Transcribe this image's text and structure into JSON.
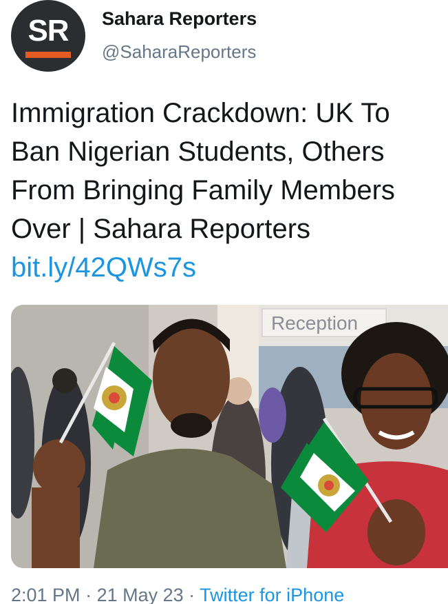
{
  "account": {
    "avatar_text": "SR",
    "display_name": "Sahara Reporters",
    "handle": "@SaharaReporters"
  },
  "tweet": {
    "text": "Immigration Crackdown: UK To Ban Nigerian Students, Others From Bringing Family Members Over | Sahara Reporters ",
    "link": "bit.ly/42QWs7s"
  },
  "media": {
    "sign_text": "Reception",
    "flag_colors": {
      "green": "#0b8a3c",
      "white": "#ffffff"
    }
  },
  "meta": {
    "time": "2:01 PM",
    "separator": " · ",
    "date": "21 May 23",
    "source": "Twitter for iPhone"
  },
  "colors": {
    "link": "#1b95e0",
    "muted": "#657786",
    "text": "#14171a",
    "brand_orange": "#e55b24",
    "avatar_bg": "#2b2d30"
  }
}
